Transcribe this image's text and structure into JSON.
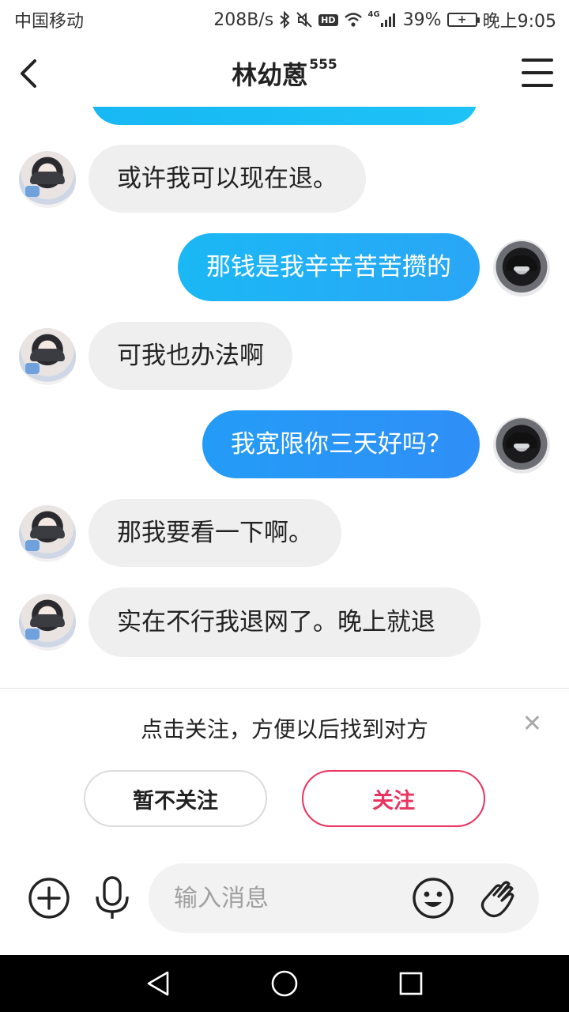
{
  "status_bar": {
    "carrier": "中国移动",
    "net_speed": "208B/s",
    "signal_tag": "4G",
    "hd_badge": "HD",
    "battery_pct": "39%",
    "time": "晚上9:05",
    "icons": [
      "bluetooth-icon",
      "mute-icon",
      "hd-icon",
      "wifi-icon",
      "signal-icon",
      "battery-charging-icon"
    ]
  },
  "header": {
    "title": "林幼蒽",
    "title_sup": "555",
    "back_icon": "chevron-left-icon",
    "menu_icon": "hamburger-menu-icon"
  },
  "messages": [
    {
      "side": "left",
      "text": "或许我可以现在退。"
    },
    {
      "side": "right",
      "text": "那钱是我辛辛苦苦攒的"
    },
    {
      "side": "left",
      "text": "可我也办法啊"
    },
    {
      "side": "right",
      "text": "我宽限你三天好吗？"
    },
    {
      "side": "left",
      "text": "那我要看一下啊。"
    },
    {
      "side": "left",
      "text": "实在不行我退网了。晚上就退"
    }
  ],
  "follow_prompt": {
    "text": "点击关注，方便以后找到对方",
    "skip_label": "暂不关注",
    "follow_label": "关注",
    "close_icon": "close-icon"
  },
  "input_bar": {
    "placeholder": "输入消息",
    "icons": [
      "add-circle-icon",
      "microphone-icon",
      "emoji-icon",
      "wave-hand-icon"
    ]
  },
  "colors": {
    "bubble_blue_start": "#1ab8f5",
    "bubble_blue_end": "#2f8ff7",
    "bubble_gray": "#efefef",
    "follow_accent": "#ea3360",
    "nav_bar": "#000000"
  }
}
